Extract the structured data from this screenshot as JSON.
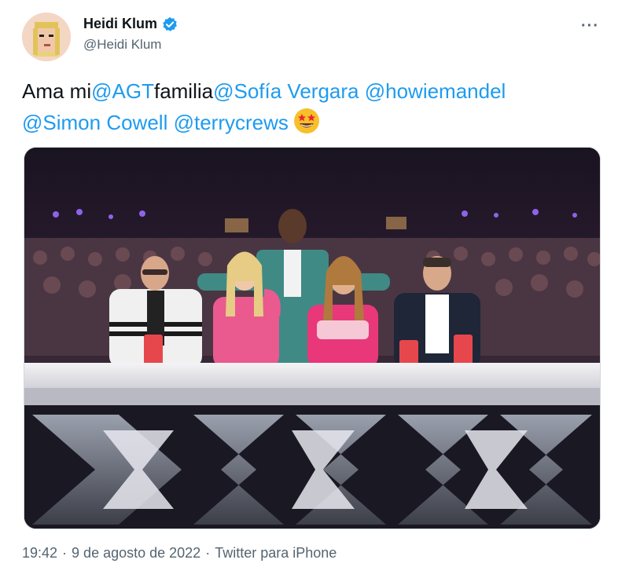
{
  "author": {
    "display_name": "Heidi Klum",
    "handle": "@Heidi Klum",
    "verified": true
  },
  "menu": {
    "more_label": "···"
  },
  "tweet": {
    "segments": [
      {
        "text": "Ama mi",
        "type": "text"
      },
      {
        "text": "@AGT",
        "type": "mention"
      },
      {
        "text": "familia",
        "type": "text"
      },
      {
        "text": "@Sofía Vergara",
        "type": "mention"
      },
      {
        "text": " ",
        "type": "text"
      },
      {
        "text": "@howiemandel",
        "type": "mention"
      },
      {
        "text": "@Simon Cowell",
        "type": "mention"
      },
      {
        "text": " ",
        "type": "text"
      },
      {
        "text": "@terrycrews",
        "type": "mention"
      }
    ],
    "emoji": "star-struck-emoji"
  },
  "footer": {
    "time": "19:42",
    "separator": "·",
    "date": "9 de agosto de 2022",
    "source": "Twitter para iPhone"
  },
  "colors": {
    "mention": "#1d9bf0",
    "verified": "#1d9bf0",
    "secondary_text": "#536471"
  }
}
